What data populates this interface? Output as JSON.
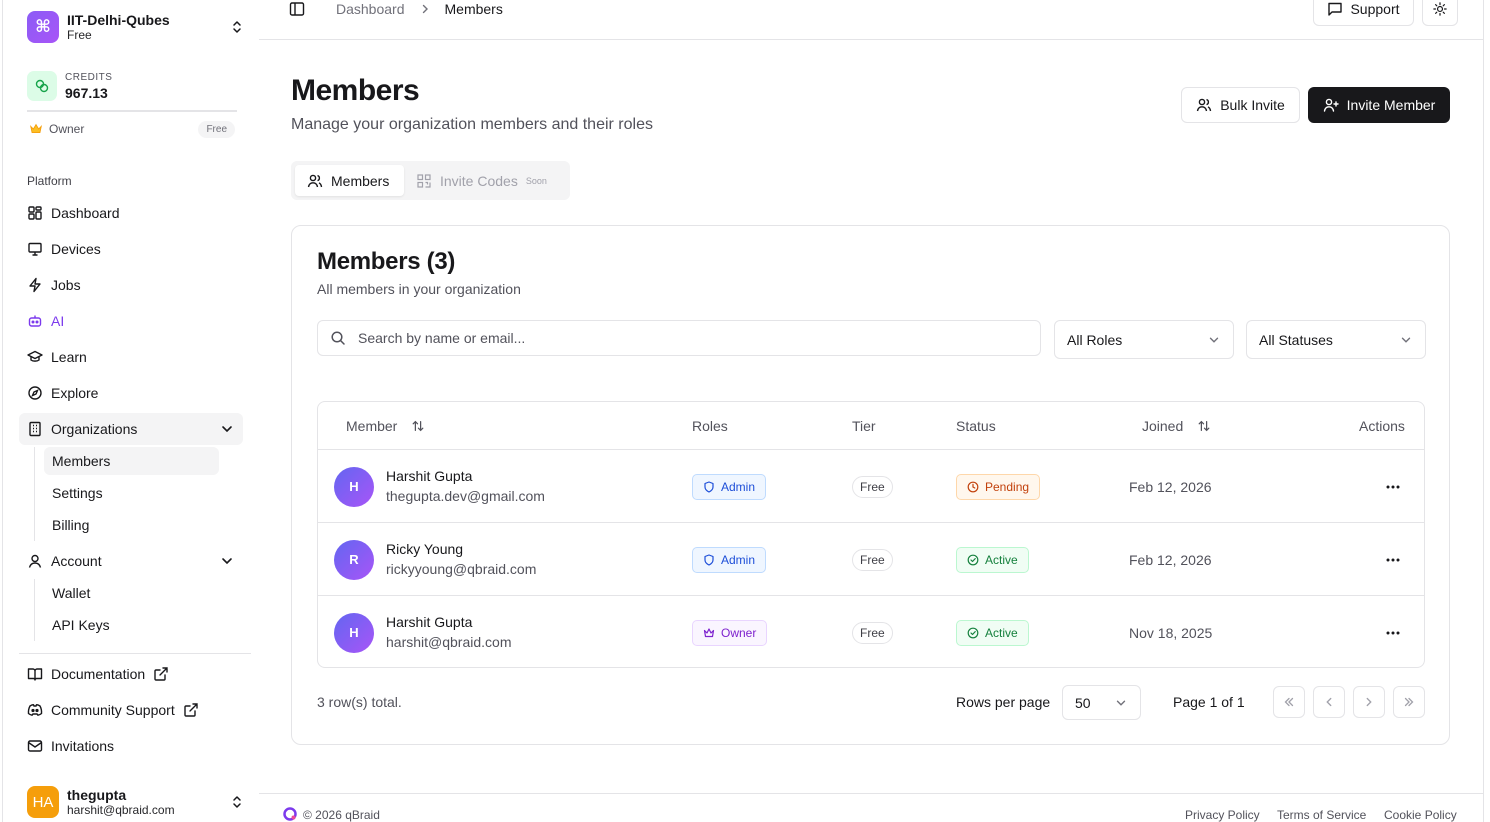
{
  "org": {
    "name": "IIT-Delhi-Qubes",
    "plan": "Free"
  },
  "credits": {
    "label": "CREDITS",
    "value": "967.13"
  },
  "role": {
    "label": "Owner",
    "plan": "Free"
  },
  "sidebar": {
    "section_label": "Platform",
    "items": [
      {
        "label": "Dashboard",
        "icon": "dashboard-icon"
      },
      {
        "label": "Devices",
        "icon": "monitor-icon"
      },
      {
        "label": "Jobs",
        "icon": "zap-icon"
      },
      {
        "label": "AI",
        "icon": "bot-icon"
      },
      {
        "label": "Learn",
        "icon": "graduation-cap-icon"
      },
      {
        "label": "Explore",
        "icon": "compass-icon"
      },
      {
        "label": "Organizations",
        "icon": "building-icon"
      }
    ],
    "org_sub": [
      "Members",
      "Settings",
      "Billing"
    ],
    "account": {
      "label": "Account",
      "icon": "user-icon"
    },
    "account_sub": [
      "Wallet",
      "API Keys"
    ],
    "links": [
      {
        "label": "Documentation",
        "icon": "book-icon"
      },
      {
        "label": "Community Support",
        "icon": "discord-icon"
      },
      {
        "label": "Invitations",
        "icon": "mail-icon"
      }
    ]
  },
  "user": {
    "initials": "HA",
    "name": "thegupta",
    "email": "harshit@qbraid.com"
  },
  "header": {
    "breadcrumb": [
      "Dashboard",
      "Members"
    ],
    "support_label": "Support"
  },
  "page": {
    "title": "Members",
    "subtitle": "Manage your organization members and their roles",
    "bulk_invite_label": "Bulk Invite",
    "invite_member_label": "Invite Member"
  },
  "tabs": {
    "members": "Members",
    "invite_codes": "Invite Codes",
    "soon": "Soon"
  },
  "card": {
    "title": "Members (3)",
    "subtitle": "All members in your organization",
    "search_placeholder": "Search by name or email...",
    "roles_filter": "All Roles",
    "status_filter": "All Statuses"
  },
  "table": {
    "columns": [
      "Member",
      "Roles",
      "Tier",
      "Status",
      "Joined",
      "Actions"
    ],
    "rows": [
      {
        "initial": "H",
        "name": "Harshit Gupta",
        "email": "thegupta.dev@gmail.com",
        "role": "Admin",
        "tier": "Free",
        "status": "Pending",
        "joined": "Feb 12, 2026"
      },
      {
        "initial": "R",
        "name": "Ricky Young",
        "email": "rickyyoung@qbraid.com",
        "role": "Admin",
        "tier": "Free",
        "status": "Active",
        "joined": "Feb 12, 2026"
      },
      {
        "initial": "H",
        "name": "Harshit Gupta",
        "email": "harshit@qbraid.com",
        "role": "Owner",
        "tier": "Free",
        "status": "Active",
        "joined": "Nov 18, 2025"
      }
    ]
  },
  "pagination": {
    "total": "3 row(s) total.",
    "rows_per_page_label": "Rows per page",
    "rows_per_page": "50",
    "page_info": "Page 1 of 1"
  },
  "footer": {
    "copyright": "© 2026 qBraid",
    "links": [
      "Privacy Policy",
      "Terms of Service",
      "Cookie Policy"
    ]
  },
  "colors": {
    "primary": "#18181b",
    "accent": "#8b5cf6",
    "admin": "#1d4ed8",
    "owner": "#7e22ce",
    "pending": "#c2410c",
    "active": "#15803d"
  }
}
